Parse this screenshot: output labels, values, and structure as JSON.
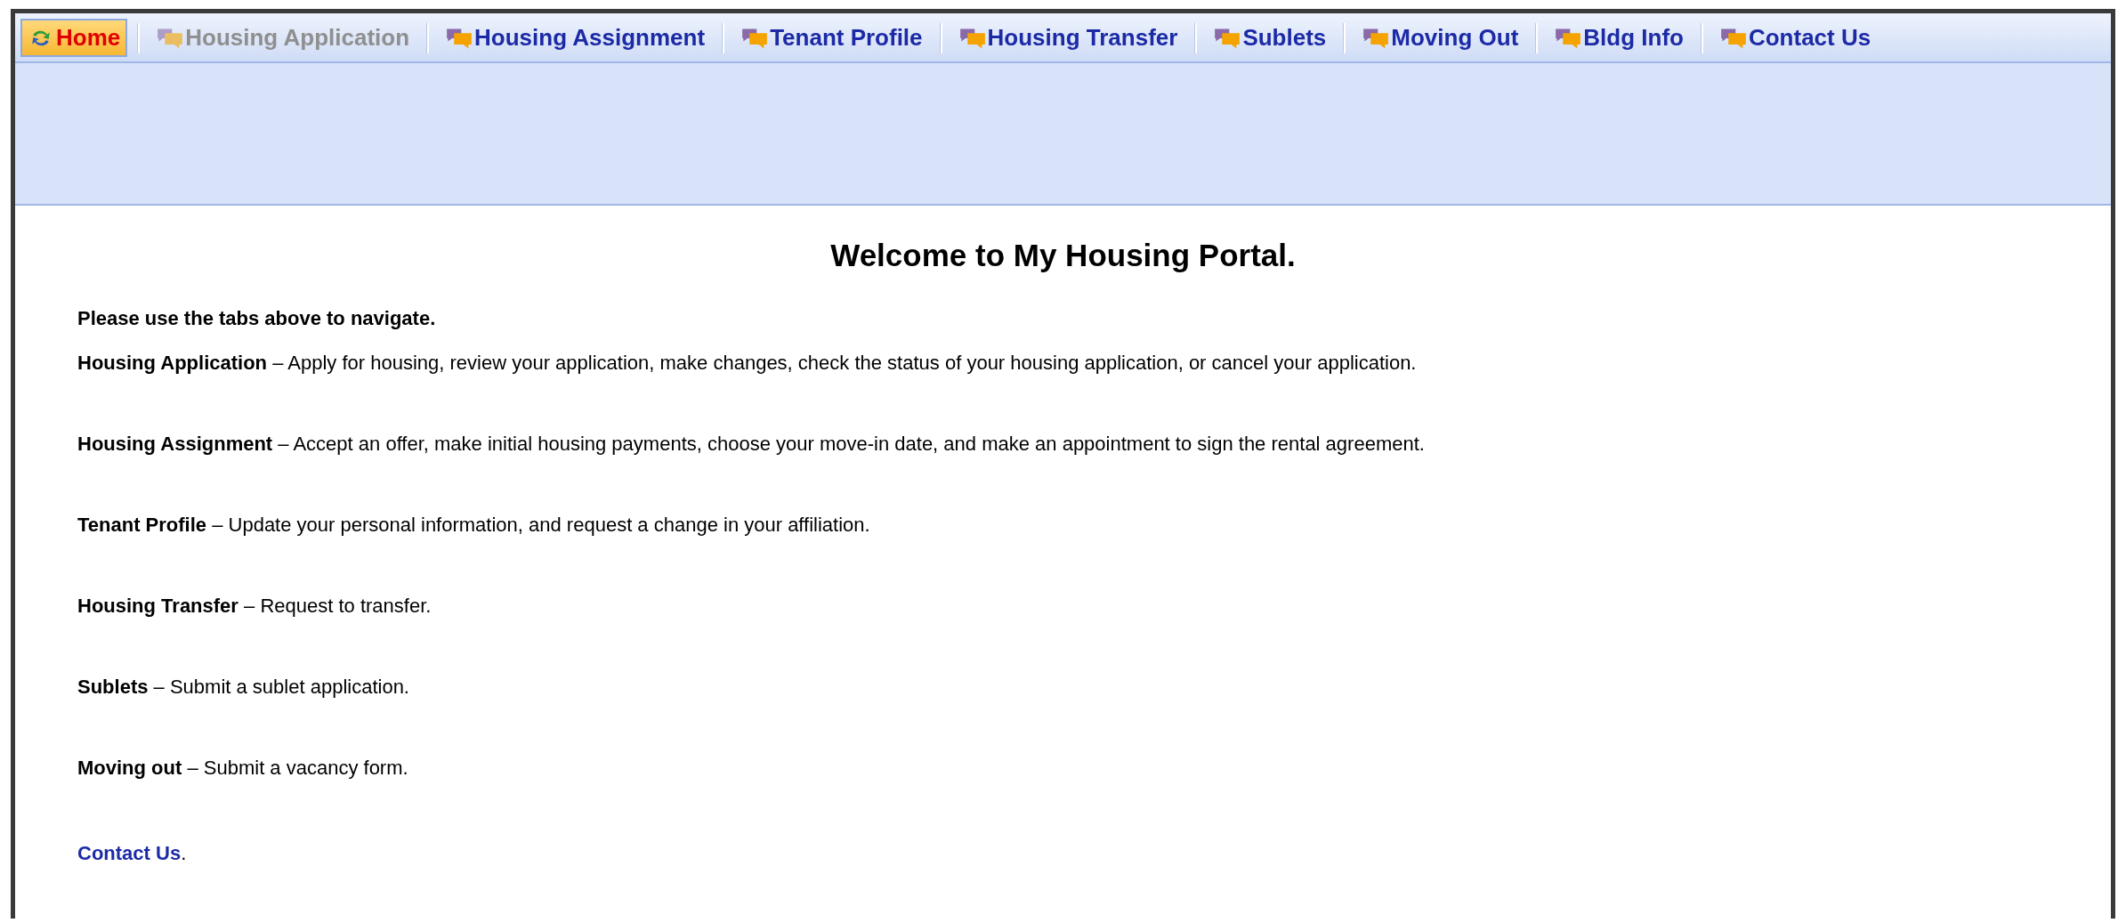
{
  "tabs": [
    {
      "label": "Home",
      "kind": "home",
      "selected": true,
      "disabled": false
    },
    {
      "label": "Housing Application",
      "kind": "section",
      "selected": false,
      "disabled": true
    },
    {
      "label": "Housing Assignment",
      "kind": "section",
      "selected": false,
      "disabled": false
    },
    {
      "label": "Tenant Profile",
      "kind": "section",
      "selected": false,
      "disabled": false
    },
    {
      "label": "Housing Transfer",
      "kind": "section",
      "selected": false,
      "disabled": false
    },
    {
      "label": "Sublets",
      "kind": "section",
      "selected": false,
      "disabled": false
    },
    {
      "label": "Moving Out",
      "kind": "section",
      "selected": false,
      "disabled": false
    },
    {
      "label": "Bldg Info",
      "kind": "section",
      "selected": false,
      "disabled": false
    },
    {
      "label": "Contact Us",
      "kind": "section",
      "selected": false,
      "disabled": false
    }
  ],
  "content": {
    "title": "Welcome to My Housing Portal.",
    "intro": "Please use the tabs above to navigate.",
    "paragraphs": [
      "**Housing Application** – Apply for housing, review your application, make changes, check the status of your housing application, or cancel your application.",
      "**Housing Assignment** – Accept an offer, make initial housing payments, choose your move-in date, and make an appointment to sign the rental agreement.",
      "**Tenant Profile** – Update your personal information, and request a change in your affiliation.",
      "**Housing Transfer** – Request to transfer.",
      "**Sublets** – Submit a sublet application.",
      "**Moving out** – Submit a vacancy form."
    ],
    "contact": {
      "link": "Contact Us",
      "after": "."
    }
  }
}
